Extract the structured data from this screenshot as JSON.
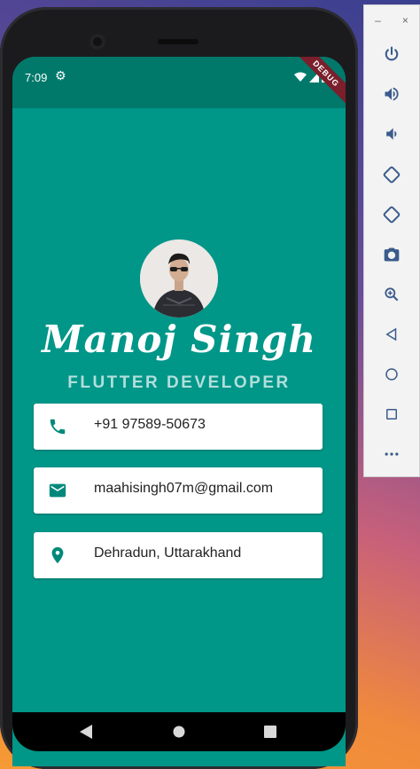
{
  "status_bar": {
    "time": "7:09",
    "debug_banner": "DEBUG"
  },
  "profile": {
    "name": "Manoj Singh",
    "title": "FLUTTER DEVELOPER"
  },
  "contacts": [
    {
      "icon": "phone-icon",
      "text": "+91 97589-50673"
    },
    {
      "icon": "email-icon",
      "text": "maahisingh07m@gmail.com"
    },
    {
      "icon": "location-icon",
      "text": "Dehradun, Uttarakhand"
    }
  ],
  "colors": {
    "primary": "#009688",
    "status_bar": "#00796b",
    "accent_text": "#b2dfdb",
    "icon": "#00897b"
  },
  "emulator_panel": {
    "window_controls": [
      "–",
      "×"
    ],
    "buttons": [
      "power-icon",
      "volume-up-icon",
      "volume-down-icon",
      "rotate-left-icon",
      "rotate-right-icon",
      "camera-icon",
      "zoom-icon",
      "back-icon",
      "home-icon",
      "overview-icon",
      "more-icon"
    ]
  }
}
